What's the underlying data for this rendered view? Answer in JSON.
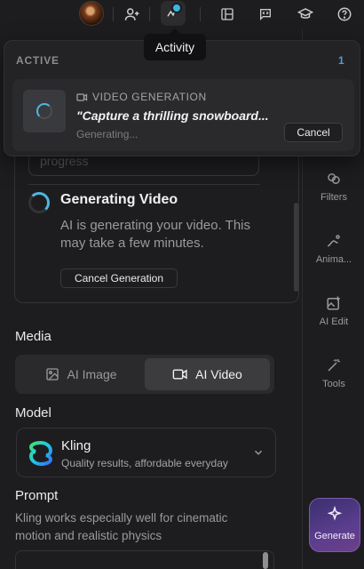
{
  "topbar": {
    "icons": [
      "avatar",
      "add-user-icon",
      "activity-icon",
      "layout-icon",
      "code-chat-icon",
      "learn-icon",
      "help-icon"
    ]
  },
  "tooltip": {
    "text": "Activity"
  },
  "activity_panel": {
    "header": "ACTIVE",
    "count": "1",
    "job": {
      "type_label": "VIDEO GENERATION",
      "prompt": "\"Capture a thrilling snowboard...",
      "status": "Generating...",
      "cancel_label": "Cancel"
    }
  },
  "generation_card": {
    "progress_placeholder": "progress",
    "title": "Generating Video",
    "description": "AI is generating your video. This may take a few minutes.",
    "cancel_label": "Cancel Generation"
  },
  "media": {
    "label": "Media",
    "options": [
      "AI Image",
      "AI Video"
    ],
    "selected": "AI Video"
  },
  "model": {
    "label": "Model",
    "name": "Kling",
    "subtitle": "Quality results, affordable everyday"
  },
  "prompt": {
    "label": "Prompt",
    "description": "Kling works especially well for cinematic motion and realistic physics"
  },
  "sidebar": {
    "items": [
      {
        "label": "Filters",
        "icon": "filters-icon"
      },
      {
        "label": "Anima...",
        "icon": "animate-icon"
      },
      {
        "label": "AI Edit",
        "icon": "ai-edit-icon"
      },
      {
        "label": "Tools",
        "icon": "tools-icon"
      }
    ],
    "generate_label": "Generate"
  },
  "colors": {
    "accent": "#4fb6e0",
    "activity_dot": "#36b7e6",
    "generate_bg": "#5b3e8e"
  }
}
